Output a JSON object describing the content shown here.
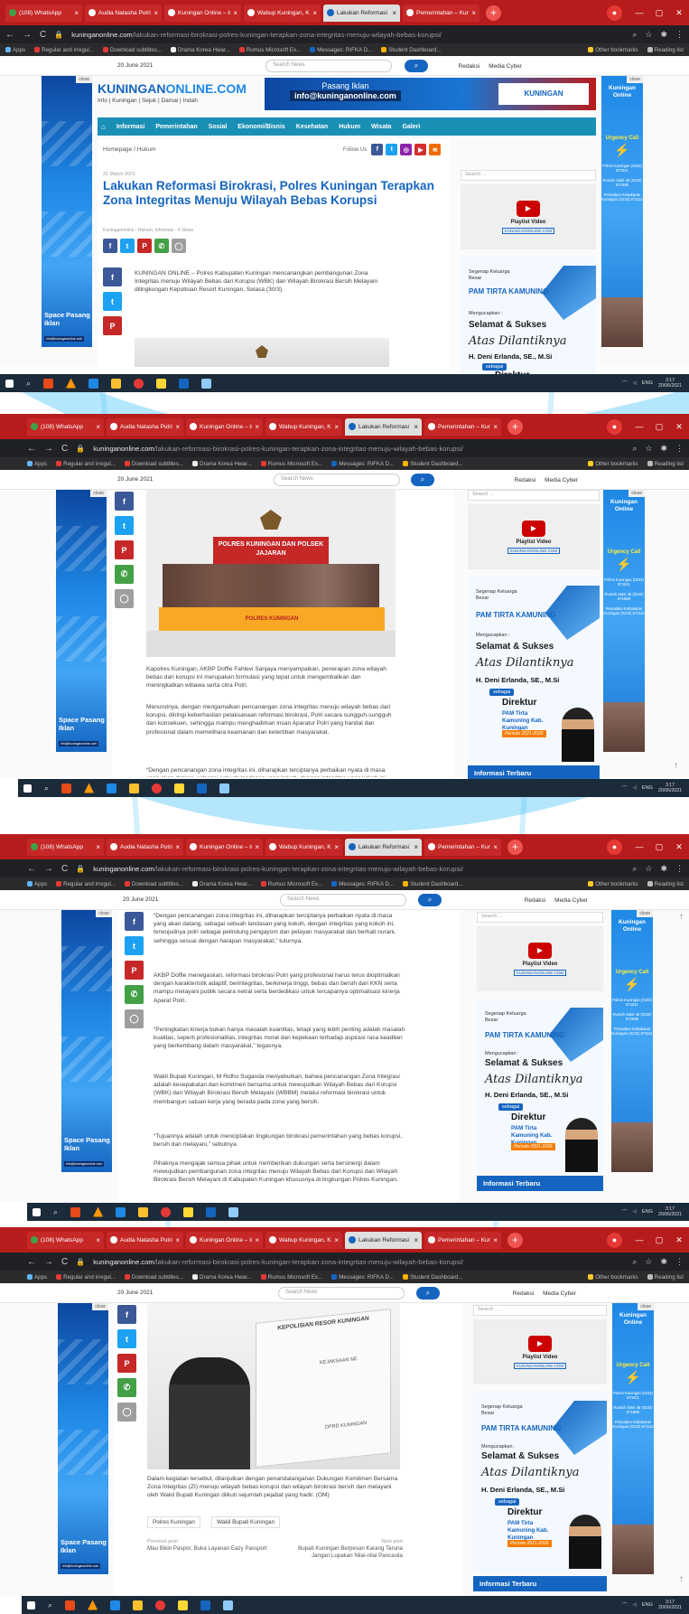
{
  "browser": {
    "tabs": [
      {
        "title": "(108) WhatsApp",
        "color": "#43a047"
      },
      {
        "title": "Audia Natasha Putri",
        "color": "#c62828"
      },
      {
        "title": "Kuningan Online – Inf",
        "color": "#c62828"
      },
      {
        "title": "Wabup Kuningan, Ka",
        "color": "#c62828"
      },
      {
        "title": "Lakukan Reformasi Bi",
        "color": "#1565c0"
      },
      {
        "title": "Pemerintahan – Kunin",
        "color": "#c62828"
      }
    ],
    "tab_close": "×",
    "new_tab": "+",
    "url_domain": "kuninganonline.com",
    "url_path": "/lakukan-reformasi-birokrasi-polres-kuningan-terapkan-zona-integritas-menuju-wilayah-bebas-korupsi/",
    "bookmarks": [
      "Apps",
      "Regular and irregul...",
      "Download subtitles...",
      "Drama Korea Hwar...",
      "Rumus Microsoft Ex...",
      "Messages: RIFKA D...",
      "Student Dashboard..."
    ],
    "other_bookmarks": "Other bookmarks",
    "reading_list": "Reading list"
  },
  "site": {
    "date": "20 June 2021",
    "search_placeholder": "Search News",
    "top_links": [
      "Redaksi",
      "Media Cyber"
    ],
    "logo_main": "KUNINGAN",
    "logo_accent": "ONLINE.COM",
    "tagline": "Info | Kuningan | Sejuk | Damai | Indah",
    "ad_banner_l1": "Pasang Iklan",
    "ad_banner_l2": "info@kuninganonline.com",
    "menu": [
      "Informasi",
      "Pemerintahan",
      "Sosial",
      "Ekonomi/Bisnis",
      "Kesehatan",
      "Hukum",
      "Wisata",
      "Galeri"
    ],
    "breadcrumb": [
      "Homepage",
      "Hukum"
    ],
    "follow_us": "Follow Us",
    "close": "close",
    "left_ad": "Space Pasang Iklan",
    "left_ad_email": "info@kuninganonline.com",
    "right_ad": {
      "title": "Kuningan Online",
      "urgency": "Urgency Call",
      "phones": [
        "Polres Kuningan (0232) 871611",
        "Rumah Sakit 45 (0232) 871885",
        "Pemadam Kebakaran Kuningan (0232) 871111"
      ]
    },
    "sidebar_search": "Search ...",
    "playlist": "Playlist Video",
    "playlist_sub": "KUNINGANONLINE.COM",
    "pam": {
      "segenap": "Segenap Keluarga Besar",
      "logo": "PAM TIRTA KAMUNING",
      "mengucapkan": "Mengucapkan :",
      "selamat": "Selamat & Sukses",
      "atas": "Atas Dilantiknya",
      "nama": "H. Deni Erlanda, SE., M.Si",
      "sebagai": "sebagai",
      "direktur": "Direktur",
      "kab": "PAM Tirta Kamuning Kab. Kuningan",
      "periode": "Periode 2021-2026"
    },
    "informasi_terbaru": "Informasi Terbaru"
  },
  "article": {
    "date": "31 March 2021",
    "title": "Lakukan Reformasi Birokrasi, Polres Kuningan Terapkan Zona Integritas Menuju Wilayah Bebas Korupsi",
    "meta": "Kuninganonline  -  Hukum, Informasi  -  4 Views",
    "p1": "KUNINGAN ONLINE – Polres Kabupaten Kuningan mencanangkan pembangunan Zona Integritas menuju Wilayah Bebas dari Korupsi (WBK) dan Wilayah Birokrasi Bersih Melayani dilingkungan Kepolisian Resort Kuningan, Selasa (30/3).",
    "photo1_banner": "POLRES KUNINGAN DAN POLSEK JAJARAN",
    "photo1_table": "POLRES KUNINGAN",
    "p2": "Kapolres Kuningan, AKBP Doffie Fahlevi Sanjaya menyampaikan, penerapan zona wilayah bebas dari korupsi ini merupakan formulasi yang tepat untuk mengembalikan dan meningkatkan wibawa serta citra Polri.",
    "p3": "Menurutnya, dengan mengamalkan pencanangan zona integritas menuju wilayah bebas dari korupsi, diiringi keberhasilan pelaksanaan reformasi birokrasi, Polri secara sungguh-sungguh dan konsekuen, sehingga mampu menghadirkan insan Aparatur Polri yang handal dan profesional dalam memelihara keamanan dan ketertiban masyarakat.",
    "p4": "“Dengan pencanangan zona integritas ini, diharapkan terciptanya perbaikan nyata di masa yang akan datang, sebagai sebuah landasan yang kokoh, dengan integritas yang kokoh ini, terwujudnya polri sebagai pelindung pengayom dan pelayan masyarakat dan berhati nurani, sehingga sesuai dengan harapan masyarakat,” tuturnya.",
    "p5": "AKBP Doffie menegaskan, reformasi birokrasi Polri yang profesional harus terus dioptimalkan dengan karakteristik adaptif, berintegritas, berkinerja tinggi, bebas dan bersih dari KKN serta mampu melayani publik secara netral serta berdedikasi untuk tercapainya optimalisasi kinerja Aparat Polri.",
    "p6": "“Peningkatan kinerja bukan hanya masalah kuantitas, tetapi yang lebih penting adalah masalah kualitas, seperti profesionalitas, integritas moral dan kepekaan terhadap aspirasi rasa keadilan yang berkembang dalam masyarakat,” tegasnya.",
    "p7": "Wakil Bupati Kuningan, M Ridho Suganda menyebutkan, bahwa pencanangan Zona Integrasi adalah kesepakatan dan komitmen bersama untuk mewujudkan Wilayah Bebas dari Korupsi (WBK) dan Wilayah Birokrasi Bersih Melayani (WBBM) melalui reformasi birokrasi untuk membangun satuan kerja yang berada pada zona yang bersih.",
    "p8": "“Tujuannya adalah untuk menciptakan lingkungan birokrasi pemerintahan yang bebas korupsi, bersih dan melayani,” sebutnya.",
    "p9": "Pihaknya mengajak semua pihak untuk memberikan dukungan serta bersinergi dalam mewujudkan pembangunan zona integritas menuju Wilayah Bebas dari Korupsi dan Wilayah Birokrasi Bersih Melayani di Kabupaten Kuningan khususnya di lingkungan Polres Kuningan.",
    "photo2_board": "KEPOLISIAN RESOR KUNINGAN",
    "photo2_labels": [
      "KEJAKSAAN NE",
      "DPRD KUNINGAN"
    ],
    "p10": "Dalam kegiatan tersebut, dilanjutkan dengan penandatanganan Dukungan Komitmen Bersama Zona Integritas (ZI) menuju wilayah bebas korupsi dan wilayah birokrasi bersih dan melayani oleh Wakil Bupati Kuningan diikuti sejumlah pejabat yang hadir. (OM)",
    "tags": [
      "Polres Kuningan",
      "Wakil Bupati Kuningan"
    ],
    "prev_label": "Previous post",
    "prev_title": "Mau Bikin Paspor, Buka Layanan Eazy Passport",
    "next_label": "Next post",
    "next_title": "Bupati Kuningan Berpesan Karang Taruna Jangan Lupakan Nilai-nilai Pancasila"
  },
  "taskbar": {
    "lang": "ENG",
    "time": "3:17",
    "date": "20/06/2021"
  },
  "colors": {
    "brand_blue": "#1565c0",
    "chrome_red": "#b71c1c",
    "nav_teal": "#1a8fb5"
  }
}
